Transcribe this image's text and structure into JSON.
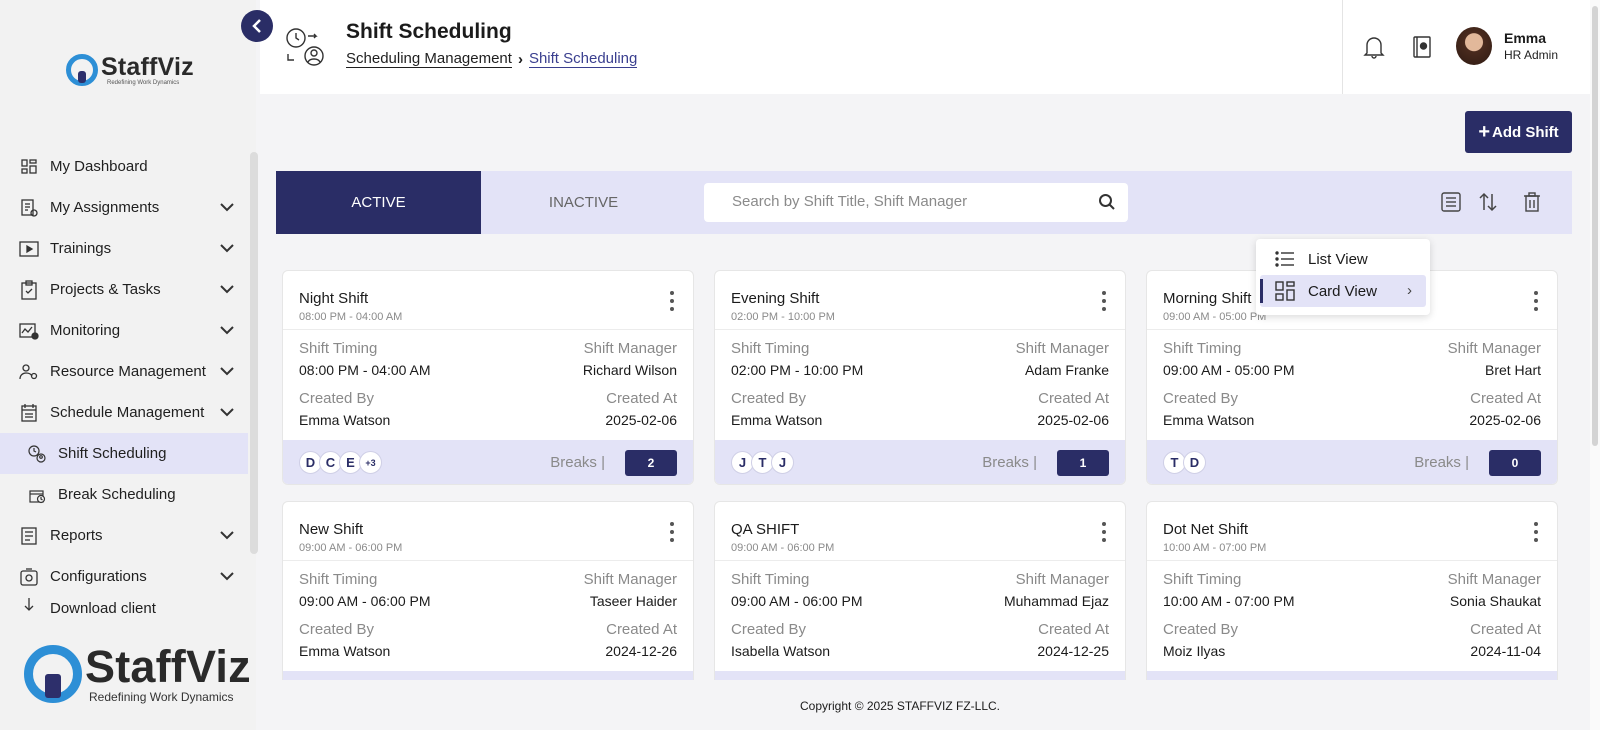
{
  "brand": {
    "name": "StaffViz",
    "tagline": "Redefining Work Dynamics"
  },
  "sidebar": {
    "items": [
      {
        "label": "My Dashboard",
        "icon": "dashboard-icon",
        "has_children": false
      },
      {
        "label": "My Assignments",
        "icon": "assignments-icon",
        "has_children": true
      },
      {
        "label": "Trainings",
        "icon": "play-icon",
        "has_children": true
      },
      {
        "label": "Projects & Tasks",
        "icon": "clipboard-icon",
        "has_children": true
      },
      {
        "label": "Monitoring",
        "icon": "monitoring-icon",
        "has_children": true
      },
      {
        "label": "Resource Management",
        "icon": "resource-icon",
        "has_children": true
      },
      {
        "label": "Schedule Management",
        "icon": "calendar-icon",
        "has_children": true
      },
      {
        "label": "Shift Scheduling",
        "icon": "shift-icon",
        "sub": true,
        "active": true
      },
      {
        "label": "Break Scheduling",
        "icon": "break-icon",
        "sub": true
      },
      {
        "label": "Reports",
        "icon": "reports-icon",
        "has_children": true
      },
      {
        "label": "Configurations",
        "icon": "config-icon",
        "has_children": true
      },
      {
        "label": "Download client",
        "icon": "download-icon"
      }
    ]
  },
  "header": {
    "title": "Shift Scheduling",
    "breadcrumb": [
      "Scheduling Management",
      "Shift Scheduling"
    ],
    "user": {
      "name": "Emma",
      "role": "HR Admin"
    }
  },
  "actions": {
    "add_shift": "Add Shift"
  },
  "tabs": {
    "active": "ACTIVE",
    "inactive": "INACTIVE"
  },
  "search": {
    "placeholder": "Search by Shift Title, Shift Manager",
    "value": ""
  },
  "view_menu": {
    "list": "List View",
    "card": "Card View",
    "selected": "Card View"
  },
  "labels": {
    "shift_timing": "Shift Timing",
    "shift_manager": "Shift Manager",
    "created_by": "Created By",
    "created_at": "Created At",
    "breaks": "Breaks |"
  },
  "cards": [
    {
      "title": "Night Shift",
      "subtitle": "08:00 PM - 04:00 AM",
      "timing": "08:00 PM - 04:00 AM",
      "manager": "Richard Wilson",
      "created_by": "Emma Watson",
      "created_at": "2025-02-06",
      "members": [
        "D",
        "C",
        "E",
        "+3"
      ],
      "breaks": "2"
    },
    {
      "title": "Evening Shift",
      "subtitle": "02:00 PM - 10:00 PM",
      "timing": "02:00 PM - 10:00 PM",
      "manager": "Adam Franke",
      "created_by": "Emma Watson",
      "created_at": "2025-02-06",
      "members": [
        "J",
        "T",
        "J"
      ],
      "breaks": "1"
    },
    {
      "title": "Morning Shift",
      "subtitle": "09:00 AM - 05:00 PM",
      "timing": "09:00 AM - 05:00 PM",
      "manager": "Bret Hart",
      "created_by": "Emma Watson",
      "created_at": "2025-02-06",
      "members": [
        "T",
        "D"
      ],
      "breaks": "0"
    },
    {
      "title": "New Shift",
      "subtitle": "09:00 AM - 06:00 PM",
      "timing": "09:00 AM - 06:00 PM",
      "manager": "Taseer Haider",
      "created_by": "Emma Watson",
      "created_at": "2024-12-26",
      "members": [],
      "breaks": ""
    },
    {
      "title": "QA SHIFT",
      "subtitle": "09:00 AM - 06:00 PM",
      "timing": "09:00 AM - 06:00 PM",
      "manager": "Muhammad Ejaz",
      "created_by": "Isabella Watson",
      "created_at": "2024-12-25",
      "members": [],
      "breaks": ""
    },
    {
      "title": "Dot Net Shift",
      "subtitle": "10:00 AM - 07:00 PM",
      "timing": "10:00 AM - 07:00 PM",
      "manager": "Sonia Shaukat",
      "created_by": "Moiz Ilyas",
      "created_at": "2024-11-04",
      "members": [],
      "breaks": ""
    }
  ],
  "footer": {
    "copyright": "Copyright © 2025 STAFFVIZ FZ-LLC."
  },
  "colors": {
    "primary": "#2a2d66",
    "accent_bg": "#e3e3f7",
    "logo_blue": "#2d8fd6"
  }
}
